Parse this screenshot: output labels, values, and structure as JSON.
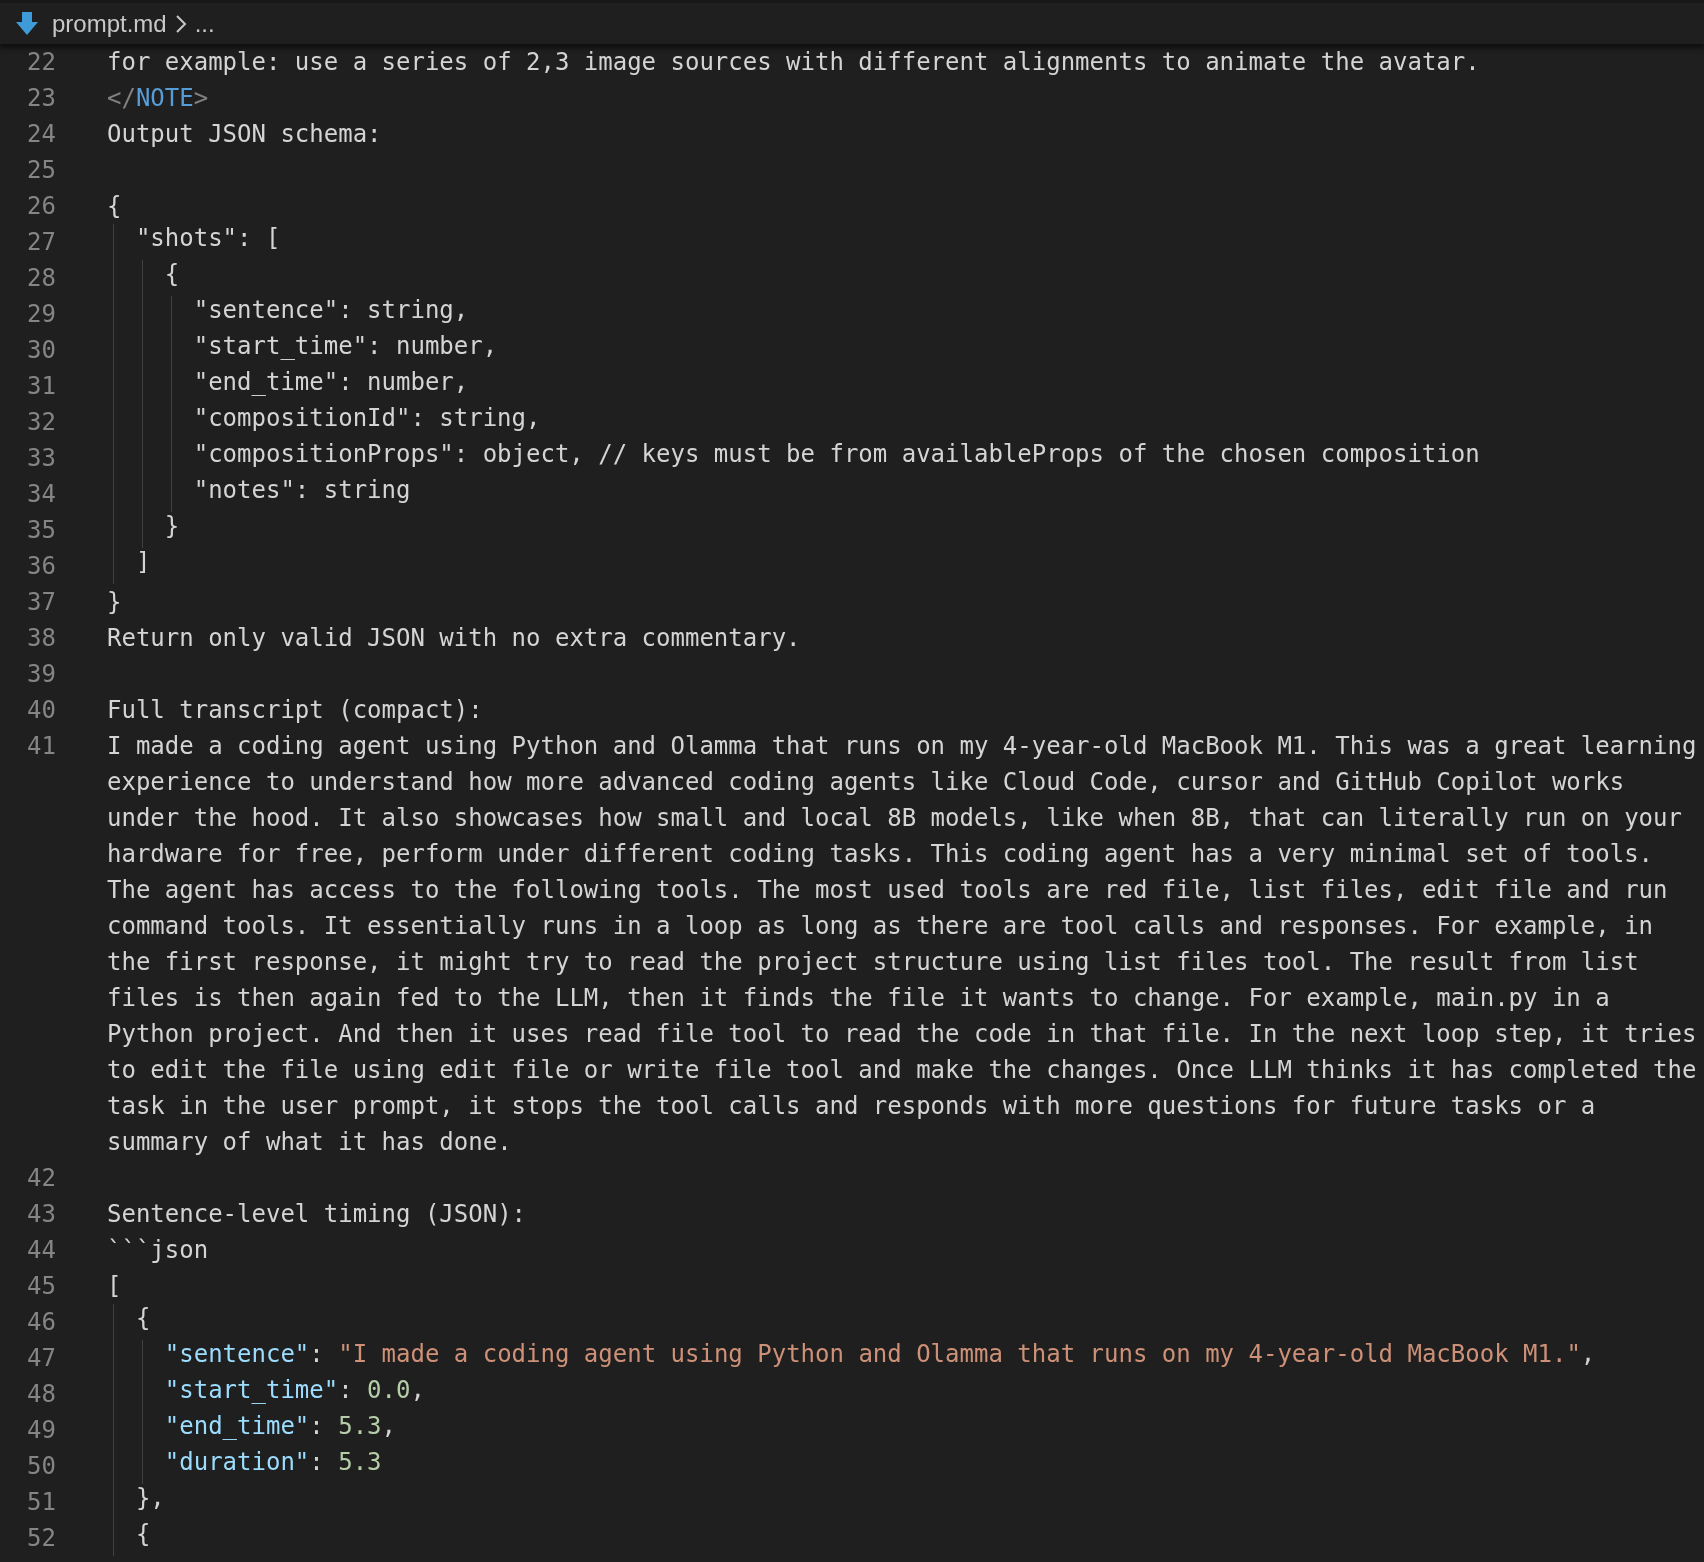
{
  "breadcrumb": {
    "file": "prompt.md",
    "trail": "..."
  },
  "lines": [
    {
      "number": "22",
      "tokens": [
        {
          "kind": "text",
          "text": "for example: use a series of 2,3 image sources with different alignments to animate the avatar."
        }
      ]
    },
    {
      "number": "23",
      "tokens": [
        {
          "kind": "punct",
          "text": "</"
        },
        {
          "kind": "tag",
          "text": "NOTE"
        },
        {
          "kind": "punct",
          "text": ">"
        }
      ]
    },
    {
      "number": "24",
      "tokens": [
        {
          "kind": "text",
          "text": "Output JSON schema:"
        }
      ]
    },
    {
      "number": "25"
    },
    {
      "number": "26",
      "tokens": [
        {
          "kind": "text",
          "text": "{"
        }
      ]
    },
    {
      "number": "27",
      "tokens": [
        {
          "kind": "text",
          "text": "  \"shots\": ["
        }
      ]
    },
    {
      "number": "28",
      "tokens": [
        {
          "kind": "text",
          "text": "    {"
        }
      ]
    },
    {
      "number": "29",
      "tokens": [
        {
          "kind": "text",
          "text": "      \"sentence\": string,"
        }
      ]
    },
    {
      "number": "30",
      "tokens": [
        {
          "kind": "text",
          "text": "      \"start_time\": number,"
        }
      ]
    },
    {
      "number": "31",
      "tokens": [
        {
          "kind": "text",
          "text": "      \"end_time\": number,"
        }
      ]
    },
    {
      "number": "32",
      "tokens": [
        {
          "kind": "text",
          "text": "      \"compositionId\": string,"
        }
      ]
    },
    {
      "number": "33",
      "tokens": [
        {
          "kind": "text",
          "text": "      \"compositionProps\": object, // keys must be from availableProps of the chosen composition"
        }
      ]
    },
    {
      "number": "34",
      "tokens": [
        {
          "kind": "text",
          "text": "      \"notes\": string"
        }
      ]
    },
    {
      "number": "35",
      "tokens": [
        {
          "kind": "text",
          "text": "    }"
        }
      ]
    },
    {
      "number": "36",
      "tokens": [
        {
          "kind": "text",
          "text": "  ]"
        }
      ]
    },
    {
      "number": "37",
      "tokens": [
        {
          "kind": "text",
          "text": "}"
        }
      ]
    },
    {
      "number": "38",
      "tokens": [
        {
          "kind": "text",
          "text": "Return only valid JSON with no extra commentary."
        }
      ]
    },
    {
      "number": "39"
    },
    {
      "number": "40",
      "tokens": [
        {
          "kind": "text",
          "text": "Full transcript (compact):"
        }
      ]
    },
    {
      "number": "41",
      "rows": [
        "I made a coding agent using Python and Olamma that runs on my 4-year-old MacBook M1. This was a great learning",
        "experience to understand how more advanced coding agents like Cloud Code, cursor and GitHub Copilot works",
        "under the hood. It also showcases how small and local 8B models, like when 8B, that can literally run on your",
        "hardware for free, perform under different coding tasks. This coding agent has a very minimal set of tools.",
        "The agent has access to the following tools. The most used tools are red file, list files, edit file and run",
        "command tools. It essentially runs in a loop as long as there are tool calls and responses. For example, in",
        "the first response, it might try to read the project structure using list files tool. The result from list",
        "files is then again fed to the LLM, then it finds the file it wants to change. For example, main.py in a",
        "Python project. And then it uses read file tool to read the code in that file. In the next loop step, it tries",
        "to edit the file using edit file or write file tool and make the changes. Once LLM thinks it has completed the",
        "task in the user prompt, it stops the tool calls and responds with more questions for future tasks or a",
        "summary of what it has done."
      ]
    },
    {
      "number": "42"
    },
    {
      "number": "43",
      "tokens": [
        {
          "kind": "text",
          "text": "Sentence-level timing (JSON):"
        }
      ]
    },
    {
      "number": "44",
      "tokens": [
        {
          "kind": "text",
          "text": "```json"
        }
      ]
    },
    {
      "number": "45",
      "tokens": [
        {
          "kind": "text",
          "text": "["
        }
      ]
    },
    {
      "number": "46",
      "tokens": [
        {
          "kind": "text",
          "text": "  {"
        }
      ]
    },
    {
      "number": "47",
      "tokens": [
        {
          "kind": "key",
          "text": "    \"sentence\""
        },
        {
          "kind": "text",
          "text": ": "
        },
        {
          "kind": "string",
          "text": "\"I made a coding agent using Python and Olamma that runs on my 4-year-old MacBook M1.\""
        },
        {
          "kind": "text",
          "text": ","
        }
      ]
    },
    {
      "number": "48",
      "tokens": [
        {
          "kind": "key",
          "text": "    \"start_time\""
        },
        {
          "kind": "text",
          "text": ": "
        },
        {
          "kind": "number",
          "text": "0.0"
        },
        {
          "kind": "text",
          "text": ","
        }
      ]
    },
    {
      "number": "49",
      "tokens": [
        {
          "kind": "key",
          "text": "    \"end_time\""
        },
        {
          "kind": "text",
          "text": ": "
        },
        {
          "kind": "number",
          "text": "5.3"
        },
        {
          "kind": "text",
          "text": ","
        }
      ]
    },
    {
      "number": "50",
      "tokens": [
        {
          "kind": "key",
          "text": "    \"duration\""
        },
        {
          "kind": "text",
          "text": ": "
        },
        {
          "kind": "number",
          "text": "5.3"
        }
      ]
    },
    {
      "number": "51",
      "tokens": [
        {
          "kind": "text",
          "text": "  },"
        }
      ]
    },
    {
      "number": "52",
      "tokens": [
        {
          "kind": "text",
          "text": "  {"
        }
      ]
    }
  ]
}
